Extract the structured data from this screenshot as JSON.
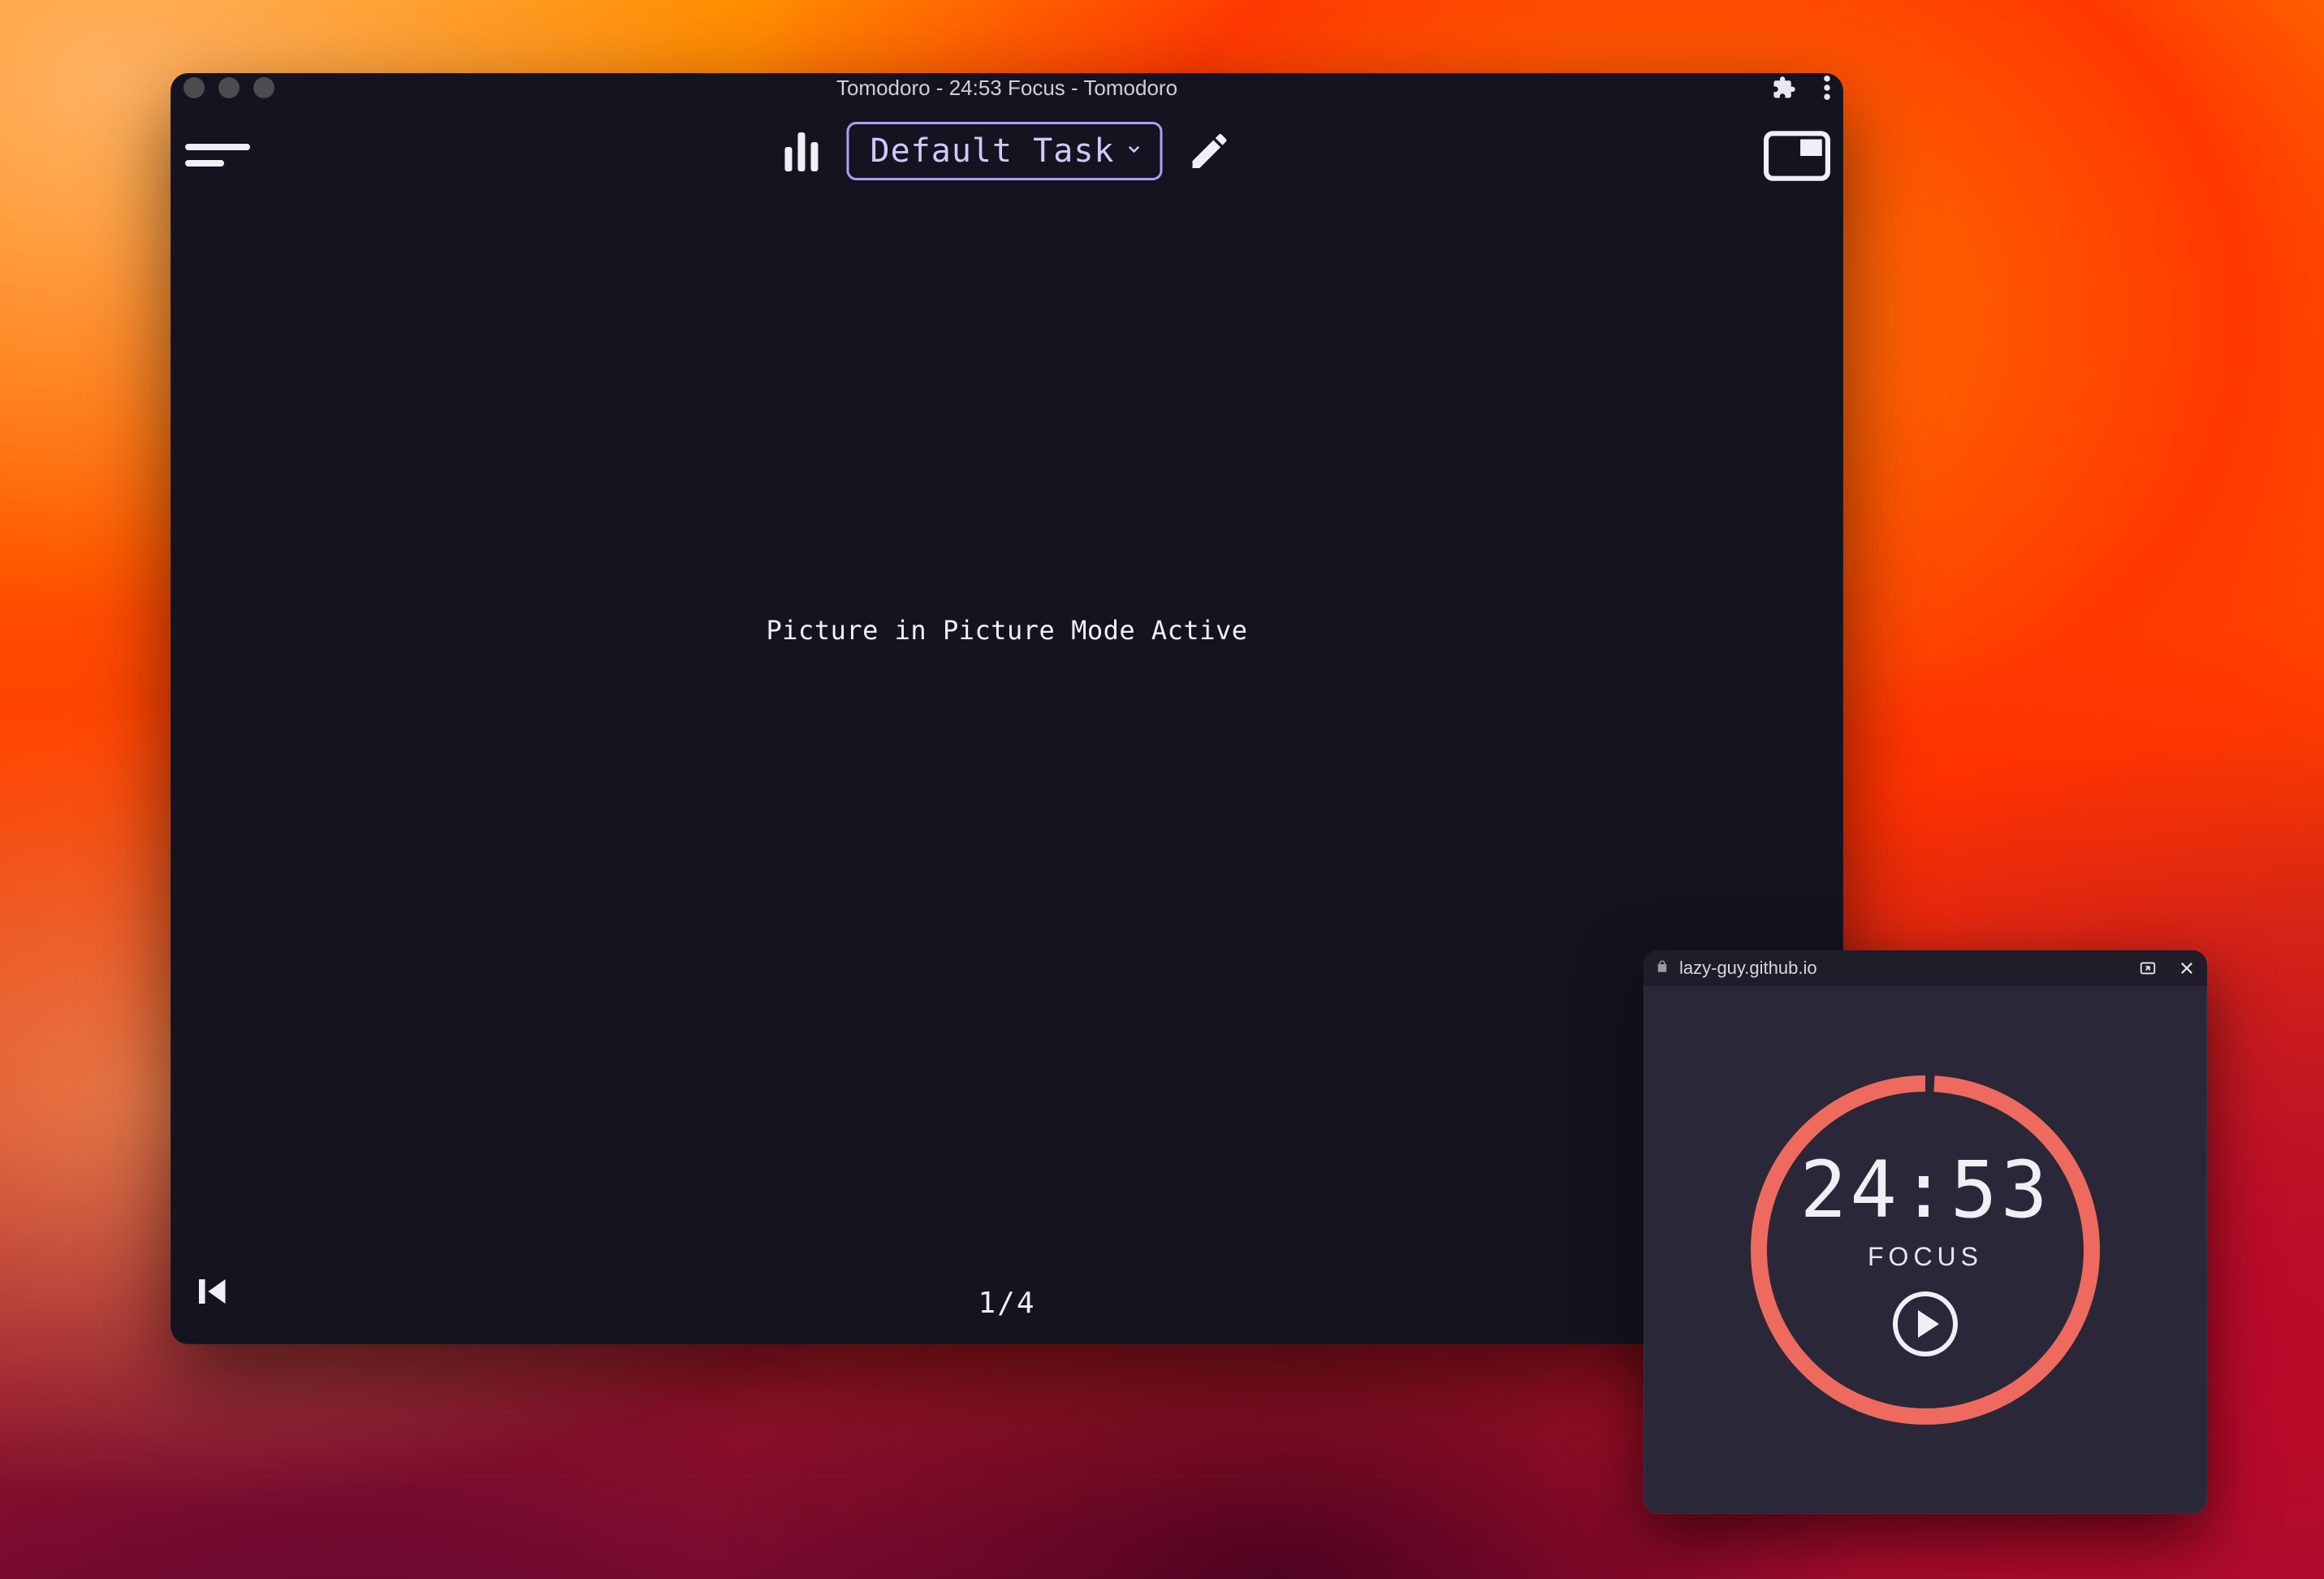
{
  "window": {
    "title": "Tomodoro - 24:53 Focus - Tomodoro"
  },
  "toolbar": {
    "task_label": "Default Task"
  },
  "body": {
    "pip_message": "Picture in Picture Mode Active"
  },
  "footer": {
    "progress": "1/4"
  },
  "pip": {
    "host": "lazy-guy.github.io",
    "time": "24:53",
    "mode": "FOCUS",
    "accent_color": "#ee6a5e",
    "progress_fraction": 0.008
  }
}
